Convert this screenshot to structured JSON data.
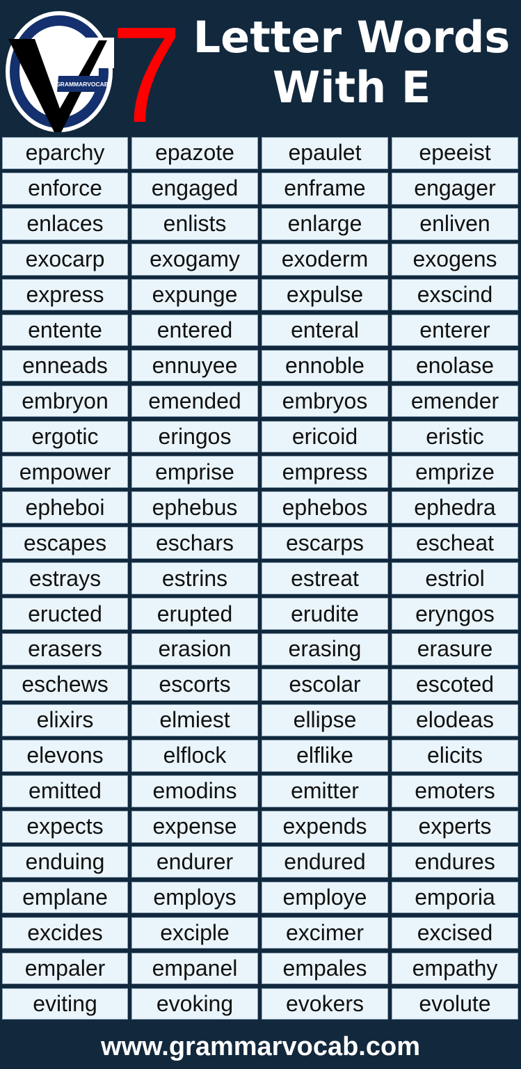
{
  "header": {
    "logo_text": "GRAMMARVOCAB",
    "number": "7",
    "title_line1": "Letter Words",
    "title_line2": "With E"
  },
  "colors": {
    "background": "#12283d",
    "accent_red": "#ff0000",
    "cell_fill": "#eaf5fb",
    "cell_border": "#8aa4b8",
    "logo_blue": "#14306e"
  },
  "words": [
    [
      "eparchy",
      "epazote",
      "epaulet",
      "epeeist"
    ],
    [
      "enforce",
      "engaged",
      "enframe",
      "engager"
    ],
    [
      "enlaces",
      "enlists",
      "enlarge",
      "enliven"
    ],
    [
      "exocarp",
      "exogamy",
      "exoderm",
      "exogens"
    ],
    [
      "express",
      "expunge",
      "expulse",
      "exscind"
    ],
    [
      "entente",
      "entered",
      "enteral",
      "enterer"
    ],
    [
      "enneads",
      "ennuyee",
      "ennoble",
      "enolase"
    ],
    [
      "embryon",
      "emended",
      "embryos",
      "emender"
    ],
    [
      "ergotic",
      "eringos",
      "ericoid",
      "eristic"
    ],
    [
      "empower",
      "emprise",
      "empress",
      "emprize"
    ],
    [
      "epheboi",
      "ephebus",
      "ephebos",
      "ephedra"
    ],
    [
      "escapes",
      "eschars",
      "escarps",
      "escheat"
    ],
    [
      "estrays",
      "estrins",
      "estreat",
      "estriol"
    ],
    [
      "eructed",
      "erupted",
      "erudite",
      "eryngos"
    ],
    [
      "erasers",
      "erasion",
      "erasing",
      "erasure"
    ],
    [
      "eschews",
      "escorts",
      "escolar",
      "escoted"
    ],
    [
      "elixirs",
      "elmiest",
      "ellipse",
      "elodeas"
    ],
    [
      "elevons",
      "elflock",
      "elflike",
      "elicits"
    ],
    [
      "emitted",
      "emodins",
      "emitter",
      "emoters"
    ],
    [
      "expects",
      "expense",
      "expends",
      "experts"
    ],
    [
      "enduing",
      "endurer",
      "endured",
      "endures"
    ],
    [
      "emplane",
      "employs",
      "employe",
      "emporia"
    ],
    [
      "excides",
      "exciple",
      "excimer",
      "excised"
    ],
    [
      "empaler",
      "empanel",
      "empales",
      "empathy"
    ],
    [
      "eviting",
      "evoking",
      "evokers",
      "evolute"
    ]
  ],
  "footer": {
    "website": "www.grammarvocab.com"
  }
}
